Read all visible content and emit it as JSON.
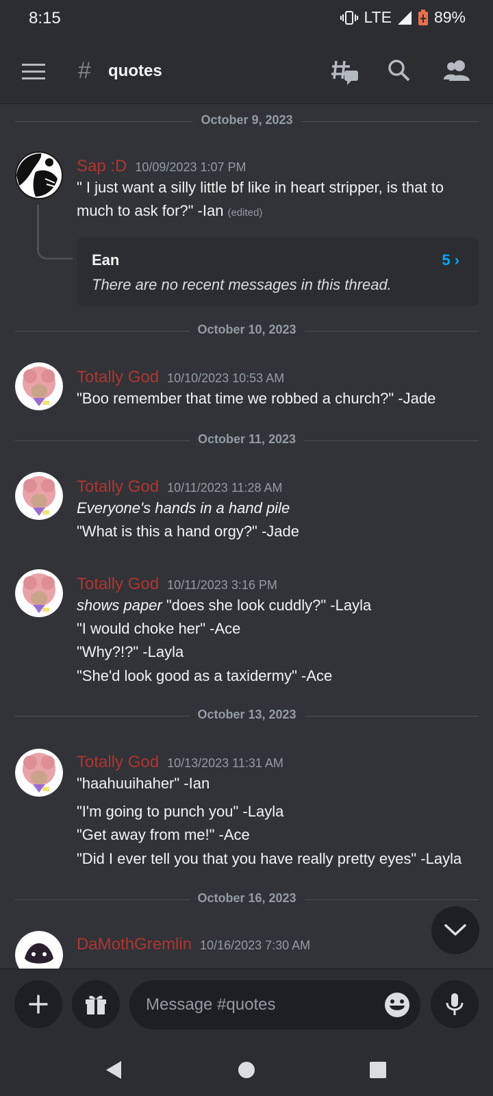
{
  "status": {
    "time": "8:15",
    "network": "LTE",
    "battery": "89%"
  },
  "header": {
    "hash": "#",
    "channel": "quotes"
  },
  "dividers": [
    "October 9, 2023",
    "October 10, 2023",
    "October 11, 2023",
    "October 13, 2023",
    "October 16, 2023"
  ],
  "messages": [
    {
      "author": "Sap :D",
      "timestamp": "10/09/2023 1:07 PM",
      "lines": [
        "\" I just want a silly little bf like in heart stripper, is that to",
        "much to ask for?\" -Ian"
      ],
      "edited": "(edited)",
      "thread": {
        "name": "Ean",
        "count": "5 ›",
        "empty": "There are no recent messages in this thread."
      }
    },
    {
      "author": "Totally God",
      "timestamp": "10/10/2023 10:53 AM",
      "lines": [
        "\"Boo remember that time we robbed a church?\" -Jade"
      ]
    },
    {
      "author": "Totally God",
      "timestamp": "10/11/2023 11:28 AM",
      "lines": [
        "Everyone's hands in a hand pile",
        "\"What is this a hand orgy?\" -Jade"
      ]
    },
    {
      "author": "Totally God",
      "timestamp": "10/11/2023 3:16 PM",
      "lines": [
        "shows paper",
        "\"does she look cuddly?\" -Layla",
        "\"I would choke her\" -Ace",
        "\"Why?!?\" -Layla",
        "\"She'd look good as a taxidermy\" -Ace"
      ]
    },
    {
      "author": "Totally God",
      "timestamp": "10/13/2023 11:31 AM",
      "lines": [
        "\"haahuuihaher\" -Ian",
        "\"I'm going to punch you\" -Layla",
        "\"Get away from me!\" -Ace",
        "\"Did I ever tell you that you have really pretty eyes\" -Layla"
      ]
    },
    {
      "author": "DaMothGremlin",
      "timestamp": "10/16/2023 7:30 AM",
      "lines": []
    }
  ],
  "composer": {
    "placeholder": "Message #quotes"
  },
  "colors": {
    "author": "#b0352f",
    "link": "#00a8fc",
    "background": "#313338"
  }
}
